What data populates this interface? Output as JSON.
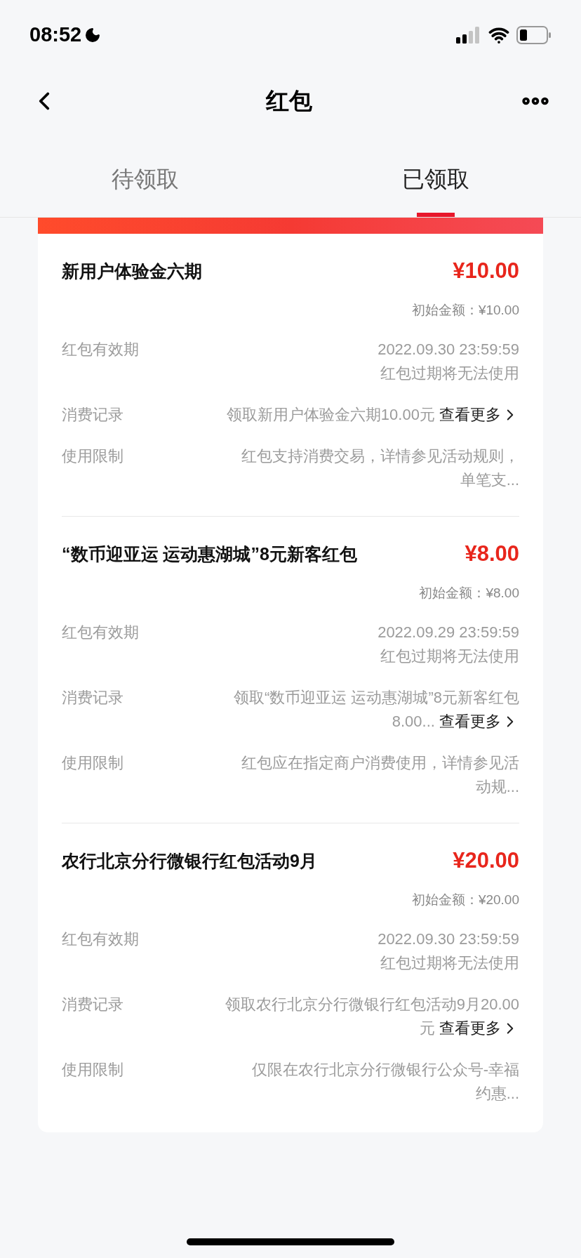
{
  "status_bar": {
    "time": "08:52"
  },
  "nav": {
    "title": "红包"
  },
  "tabs": [
    {
      "label": "待领取",
      "selected": false
    },
    {
      "label": "已领取",
      "selected": true
    }
  ],
  "packets": [
    {
      "title": "新用户体验金六期",
      "amount": "¥10.00",
      "initial": "初始金额：¥10.00",
      "rows": [
        {
          "kind": "text",
          "label": "红包有效期",
          "lines": [
            "2022.09.30 23:59:59",
            "红包过期将无法使用"
          ]
        },
        {
          "kind": "record",
          "label": "消费记录",
          "text": "领取新用户体验金六期10.00元",
          "more": "查看更多"
        },
        {
          "kind": "text",
          "label": "使用限制",
          "lines": [
            "红包支持消费交易，详情参见活动规则，单笔支..."
          ]
        }
      ]
    },
    {
      "title": "“数币迎亚运 运动惠湖城”8元新客红包",
      "amount": "¥8.00",
      "initial": "初始金额：¥8.00",
      "rows": [
        {
          "kind": "text",
          "label": "红包有效期",
          "lines": [
            "2022.09.29 23:59:59",
            "红包过期将无法使用"
          ]
        },
        {
          "kind": "record",
          "label": "消费记录",
          "text": "领取“数币迎亚运 运动惠湖城”8元新客红包8.00...",
          "more": "查看更多"
        },
        {
          "kind": "text",
          "label": "使用限制",
          "lines": [
            "红包应在指定商户消费使用，详情参见活动规..."
          ]
        }
      ]
    },
    {
      "title": "农行北京分行微银行红包活动9月",
      "amount": "¥20.00",
      "initial": "初始金额：¥20.00",
      "rows": [
        {
          "kind": "text",
          "label": "红包有效期",
          "lines": [
            "2022.09.30 23:59:59",
            "红包过期将无法使用"
          ]
        },
        {
          "kind": "record",
          "label": "消费记录",
          "text": "领取农行北京分行微银行红包活动9月20.00元",
          "more": "查看更多"
        },
        {
          "kind": "text",
          "label": "使用限制",
          "lines": [
            "仅限在农行北京分行微银行公众号-幸福约惠..."
          ]
        }
      ]
    }
  ]
}
